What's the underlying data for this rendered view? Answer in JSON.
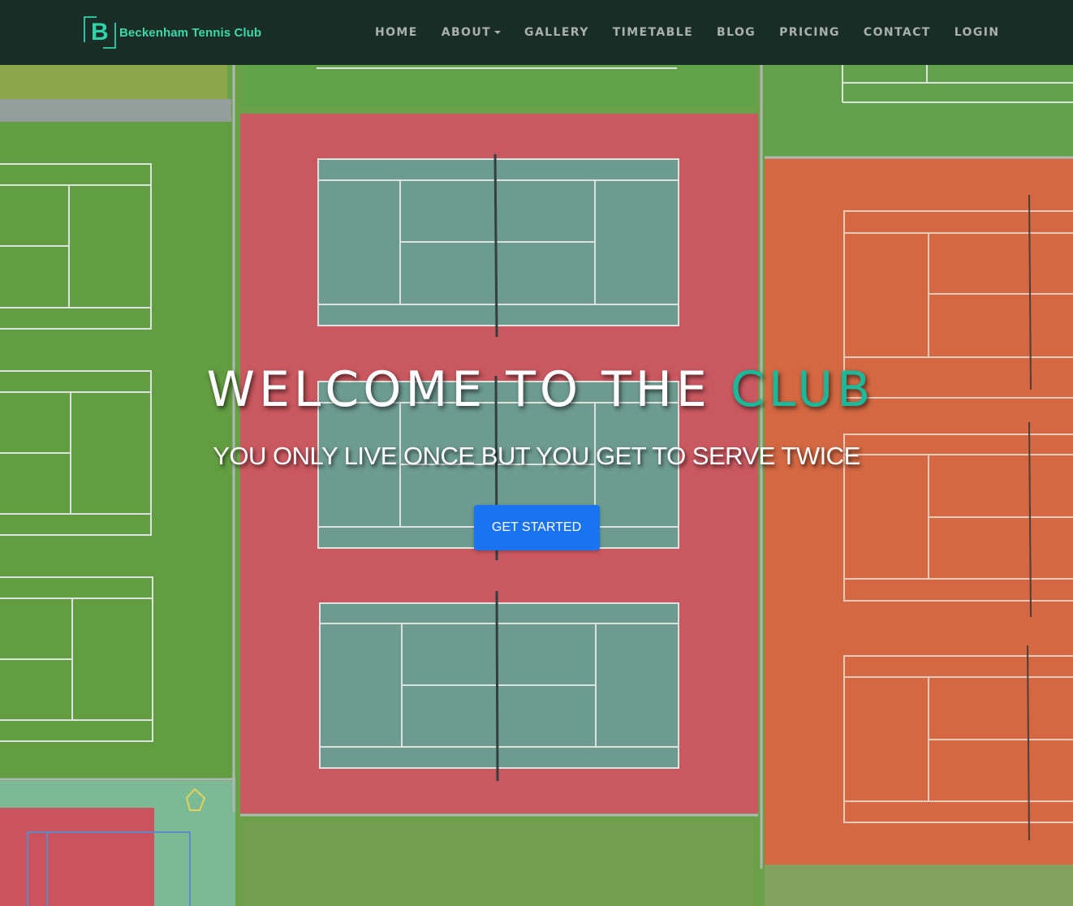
{
  "brand": {
    "logo_letter": "B",
    "name": "Beckenham Tennis Club"
  },
  "nav": {
    "items": [
      {
        "label": "HOME"
      },
      {
        "label": "ABOUT",
        "has_dropdown": true
      },
      {
        "label": "GALLERY"
      },
      {
        "label": "TIMETABLE"
      },
      {
        "label": "BLOG"
      },
      {
        "label": "PRICING"
      },
      {
        "label": "CONTACT"
      },
      {
        "label": "LOGIN"
      }
    ]
  },
  "hero": {
    "title_main": "WELCOME TO THE ",
    "title_accent": "CLUB",
    "subtitle": "YOU ONLY LIVE ONCE BUT YOU GET TO SERVE TWICE",
    "cta_label": "GET STARTED",
    "background_image": "aerial-view-of-tennis-courts"
  },
  "colors": {
    "navbar_bg": "#142424",
    "nav_text": "#a9b0ae",
    "brand_green": "#3ad9a6",
    "title_accent": "#1bb99a",
    "cta_bg": "#1a73f0"
  }
}
